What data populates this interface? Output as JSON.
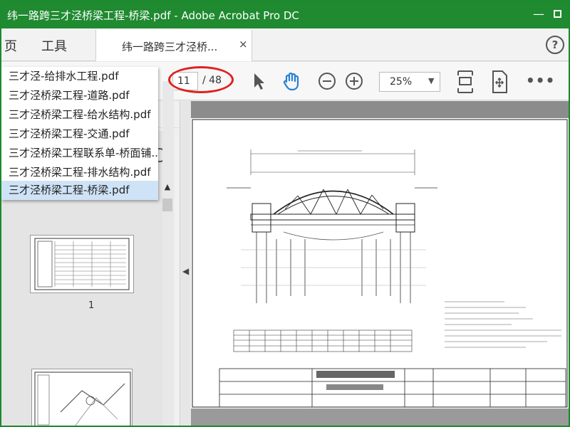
{
  "window": {
    "title": "纬一路跨三才泾桥梁工程-桥梁.pdf - Adobe Acrobat Pro DC",
    "minimize": "—"
  },
  "tabs": {
    "home": "页",
    "tools": "工具",
    "document": "纬一路跨三才泾桥...",
    "close": "×",
    "help": "?"
  },
  "toolbar": {
    "current_page": "11",
    "total_pages": "/ 48",
    "zoom": "25%",
    "more": "•••"
  },
  "file_list": {
    "items": [
      {
        "label": "三才泾-给排水工程.pdf"
      },
      {
        "label": "三才泾桥梁工程-道路.pdf"
      },
      {
        "label": "三才泾桥梁工程-给水结构.pdf"
      },
      {
        "label": "三才泾桥梁工程-交通.pdf"
      },
      {
        "label": "三才泾桥梁工程联系单-桥面铺..."
      },
      {
        "label": "三才泾桥梁工程-排水结构.pdf"
      },
      {
        "label": "三才泾桥梁工程-桥梁.pdf"
      }
    ],
    "selected_index": 6
  },
  "thumbnails": {
    "page1_label": "1"
  },
  "colors": {
    "title_bar": "#1f8a30",
    "highlight": "#e02020",
    "hand_tool": "#2a7fd4",
    "selected_item": "#cfe3f7"
  },
  "icons": [
    "minimize-icon",
    "maximize-icon",
    "help-icon",
    "select-arrow-icon",
    "hand-icon",
    "zoom-out-icon",
    "zoom-in-icon",
    "fit-page-icon",
    "full-screen-icon",
    "more-icon",
    "chevron-left-icon",
    "chevron-up-icon"
  ]
}
